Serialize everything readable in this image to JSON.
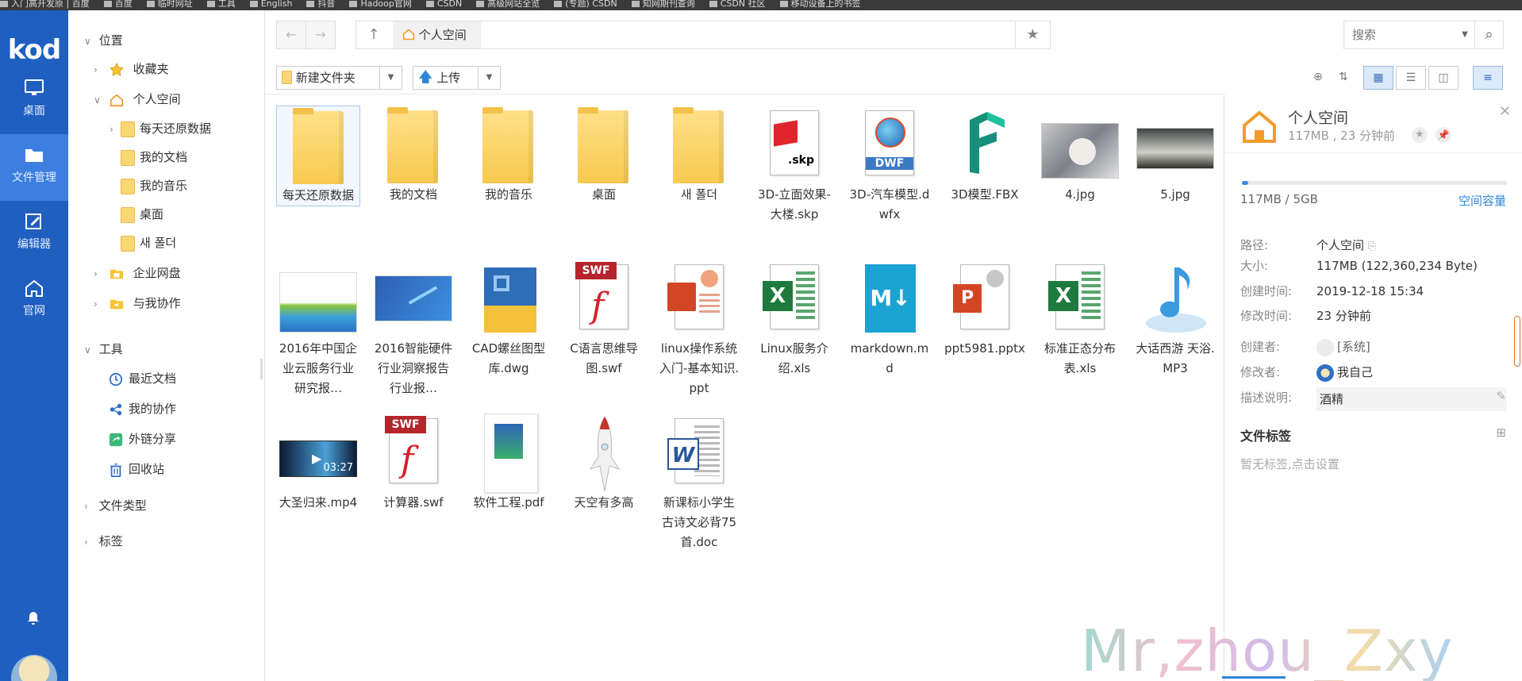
{
  "bookmarks": [
    "入门高开发原 | 百度",
    "百度",
    "临时网址",
    "工具",
    "English",
    "抖音",
    "Hadoop官网",
    "CSDN",
    "高级网站全览",
    "(专题) CSDN",
    "知网期刊查询",
    "CSDN 社区",
    "移动设备上的书签"
  ],
  "app": {
    "logo": "kod"
  },
  "rail": [
    {
      "label": "桌面",
      "icon": "desktop-icon"
    },
    {
      "label": "文件管理",
      "icon": "folder-icon"
    },
    {
      "label": "编辑器",
      "icon": "editor-icon"
    },
    {
      "label": "官网",
      "icon": "home-icon"
    }
  ],
  "tree": {
    "location": "位置",
    "favorites": "收藏夹",
    "personal": "个人空间",
    "children": [
      "每天还原数据",
      "我的文档",
      "我的音乐",
      "桌面",
      "새 폴더"
    ],
    "enterprise": "企业网盘",
    "collab": "与我协作",
    "tools": "工具",
    "tool_items": [
      "最近文档",
      "我的协作",
      "外链分享",
      "回收站"
    ],
    "filetypes": "文件类型",
    "tags": "标签"
  },
  "path": {
    "crumb": "个人空间"
  },
  "search": {
    "placeholder": "搜索"
  },
  "toolbar": {
    "new_folder": "新建文件夹",
    "upload": "上传"
  },
  "files": [
    {
      "name": "每天还原数据",
      "kind": "folder"
    },
    {
      "name": "我的文档",
      "kind": "folder"
    },
    {
      "name": "我的音乐",
      "kind": "folder"
    },
    {
      "name": "桌面",
      "kind": "folder"
    },
    {
      "name": "새 폴더",
      "kind": "folder"
    },
    {
      "name": "3D-立面效果-大楼.skp",
      "kind": "skp",
      "badge": ".skp"
    },
    {
      "name": "3D-汽车模型.dwfx",
      "kind": "dwf",
      "badge": "DWF"
    },
    {
      "name": "3D模型.FBX",
      "kind": "fbx"
    },
    {
      "name": "4.jpg",
      "kind": "img-cat"
    },
    {
      "name": "5.jpg",
      "kind": "img-sky"
    },
    {
      "name": "2016年中国企业云服务行业研究报…",
      "kind": "img-report"
    },
    {
      "name": "2016智能硬件行业洞察报告行业报…",
      "kind": "img-report2"
    },
    {
      "name": "CAD螺丝图型库.dwg",
      "kind": "dwg"
    },
    {
      "name": "C语言思维导图.swf",
      "kind": "swf",
      "badge": "SWF"
    },
    {
      "name": "linux操作系统入门-基本知识.ppt",
      "kind": "ppt"
    },
    {
      "name": "Linux服务介绍.xls",
      "kind": "xls"
    },
    {
      "name": "markdown.md",
      "kind": "md",
      "badge": "M↓"
    },
    {
      "name": "ppt5981.pptx",
      "kind": "pptx",
      "badge": "P"
    },
    {
      "name": "标准正态分布表.xls",
      "kind": "xls"
    },
    {
      "name": "大话西游 天浴.MP3",
      "kind": "mp3"
    },
    {
      "name": "大圣归来.mp4",
      "kind": "video",
      "duration": "03:27"
    },
    {
      "name": "计算器.swf",
      "kind": "swf",
      "badge": "SWF"
    },
    {
      "name": "软件工程.pdf",
      "kind": "pdf"
    },
    {
      "name": "天空有多高",
      "kind": "rocket"
    },
    {
      "name": "新课标小学生古诗文必背75首.doc",
      "kind": "doc",
      "badge": "W"
    }
  ],
  "detail": {
    "title": "个人空间",
    "subtitle": "117MB , 23 分钟前",
    "quota_text": "117MB / 5GB",
    "quota_fraction": 0.023,
    "quota_link": "空间容量",
    "rows": [
      {
        "k": "路径:",
        "v": "个人空间"
      },
      {
        "k": "大小:",
        "v": "117MB (122,360,234 Byte)"
      },
      {
        "k": "创建时间:",
        "v": "2019-12-18 15:34"
      },
      {
        "k": "修改时间:",
        "v": "23 分钟前"
      },
      {
        "k": "创建者:",
        "v": "[系统]"
      },
      {
        "k": "修改者:",
        "v": "我自己"
      },
      {
        "k": "描述说明:",
        "v": "酒精"
      }
    ],
    "tags_title": "文件标签",
    "tags_empty": "暂无标签,点击设置"
  },
  "watermark": "Mr,zhou_Zxy"
}
